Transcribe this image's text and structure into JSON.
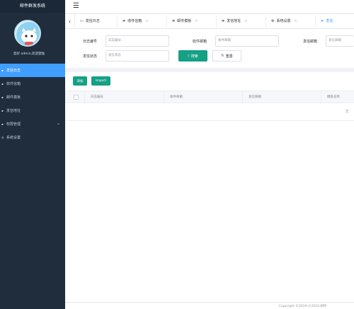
{
  "app": {
    "title": "邮件群发系统"
  },
  "user": {
    "greeting": "您好 admin,欢迎登陆"
  },
  "sidebar": {
    "items": [
      {
        "icon": "list-icon",
        "label": "发信日志",
        "active": true
      },
      {
        "icon": "list-icon",
        "label": "收件信箱",
        "active": false
      },
      {
        "icon": "list-icon",
        "label": "邮件模板",
        "active": false
      },
      {
        "icon": "list-icon",
        "label": "发信地址",
        "active": false
      },
      {
        "icon": "list-icon",
        "label": "权限管理",
        "active": false,
        "expandable": true
      },
      {
        "icon": "gear-icon",
        "label": "系统设置",
        "active": false
      }
    ]
  },
  "tabs": [
    {
      "icon": "monitor-icon",
      "label": "发信日志",
      "closable": false,
      "active": false
    },
    {
      "icon": "list-icon",
      "label": "收件信箱",
      "closable": true,
      "active": false
    },
    {
      "icon": "list-icon",
      "label": "邮件模板",
      "closable": true,
      "active": false
    },
    {
      "icon": "list-icon",
      "label": "发信地址",
      "closable": true,
      "active": false
    },
    {
      "icon": "gear-icon",
      "label": "系统设置",
      "closable": true,
      "active": false
    },
    {
      "icon": "list-icon",
      "label": "发信",
      "closable": false,
      "active": true
    }
  ],
  "search": {
    "log_id_label": "日志编号",
    "log_id_placeholder": "日志编号",
    "to_label": "收件邮箱",
    "to_placeholder": "收件邮箱",
    "from_label": "发信邮箱",
    "from_placeholder": "发信邮箱",
    "status_label": "发信状态",
    "status_placeholder": "发信状态",
    "search_button": "搜索",
    "reset_button": "重置"
  },
  "toolbar": {
    "add_button": "添加",
    "import_button": "Import"
  },
  "table": {
    "columns": [
      "日志编号",
      "收件邮箱",
      "发信邮箱",
      "模板名称"
    ],
    "empty_text": "无"
  },
  "footer": {
    "text": "Copyright ©2019-©2024 邮件"
  },
  "colors": {
    "sidebar_bg": "#1f2d3d",
    "accent": "#409eff",
    "primary_button": "#16a085"
  }
}
